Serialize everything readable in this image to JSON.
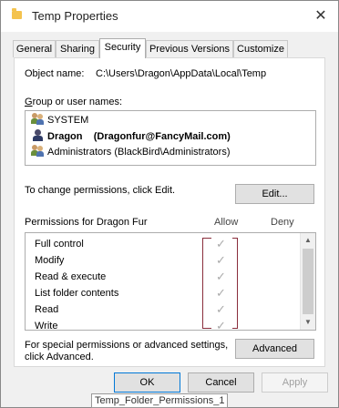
{
  "window": {
    "title": "Temp Properties",
    "close_glyph": "✕"
  },
  "tabs": [
    {
      "label": "General"
    },
    {
      "label": "Sharing"
    },
    {
      "label": "Security"
    },
    {
      "label": "Previous Versions"
    },
    {
      "label": "Customize"
    }
  ],
  "security": {
    "object_name_label": "Object name:",
    "object_name_value": "C:\\Users\\Dragon\\AppData\\Local\\Temp",
    "group_label": "Group or user names:",
    "users": [
      {
        "name": "SYSTEM",
        "icon": "group-users-icon"
      },
      {
        "name": "Dragon    (Dragonfur@FancyMail.com)",
        "icon": "single-user-icon",
        "selected": true
      },
      {
        "name": "Administrators (BlackBird\\Administrators)",
        "icon": "group-users-icon"
      }
    ],
    "change_text": "To change permissions, click Edit.",
    "edit_button": "Edit...",
    "permissions_label": "Permissions for Dragon Fur",
    "allow_header": "Allow",
    "deny_header": "Deny",
    "permissions": [
      {
        "name": "Full control",
        "allow": true,
        "deny": false
      },
      {
        "name": "Modify",
        "allow": true,
        "deny": false
      },
      {
        "name": "Read & execute",
        "allow": true,
        "deny": false
      },
      {
        "name": "List folder contents",
        "allow": true,
        "deny": false
      },
      {
        "name": "Read",
        "allow": true,
        "deny": false
      },
      {
        "name": "Write",
        "allow": true,
        "deny": false
      }
    ],
    "check_glyph": "✓",
    "special_text_1": "For special permissions or advanced settings,",
    "special_text_2": "click Advanced.",
    "advanced_button": "Advanced"
  },
  "footer": {
    "ok": "OK",
    "cancel": "Cancel",
    "apply": "Apply"
  },
  "caption": "Temp_Folder_Permissions_1"
}
